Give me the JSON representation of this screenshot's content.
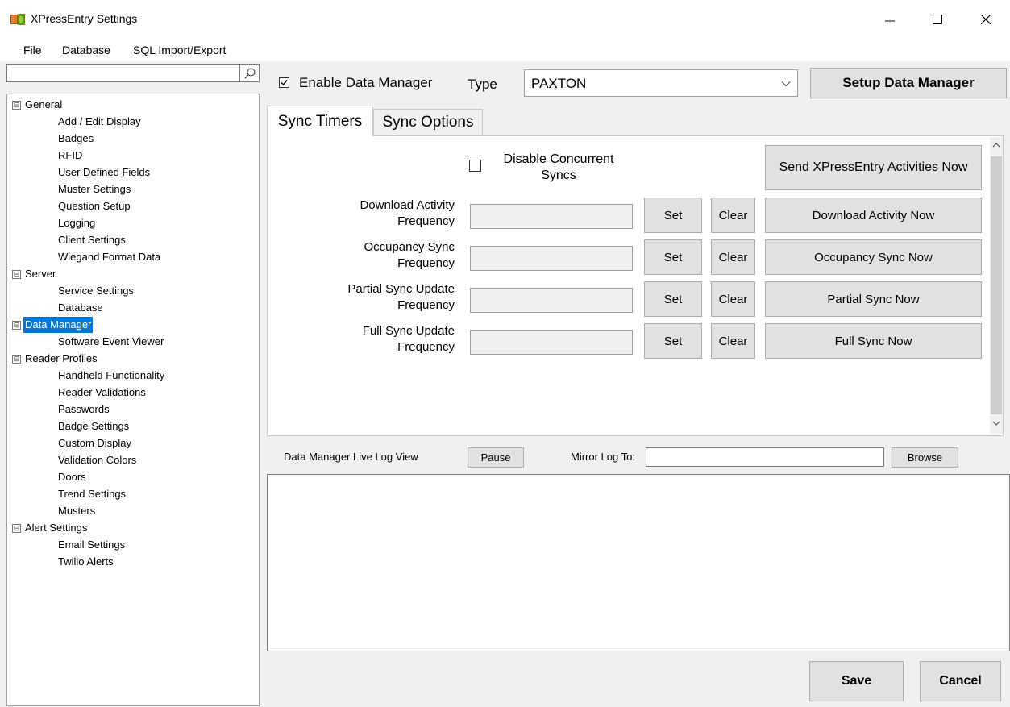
{
  "window": {
    "title": "XPressEntry Settings"
  },
  "menu": [
    "File",
    "Database",
    "SQL Import/Export"
  ],
  "search": {
    "value": "",
    "placeholder": ""
  },
  "tree": {
    "general": {
      "label": "General",
      "expander": "⊟",
      "children": [
        "Add / Edit Display",
        "Badges",
        "RFID",
        "User Defined Fields",
        "Muster Settings",
        "Question Setup",
        "Logging",
        "Client Settings",
        "Wiegand Format Data"
      ]
    },
    "server": {
      "label": "Server",
      "expander": "⊟",
      "children": [
        "Service Settings",
        "Database"
      ]
    },
    "data_manager": {
      "label": "Data Manager",
      "expander": "⊟",
      "children": [
        "Software Event Viewer"
      ],
      "selected": true
    },
    "reader_profiles": {
      "label": "Reader Profiles",
      "expander": "⊟",
      "children": [
        "Handheld Functionality",
        "Reader Validations",
        "Passwords",
        "Badge Settings",
        "Custom Display",
        "Validation Colors",
        "Doors",
        "Trend Settings",
        "Musters"
      ]
    },
    "alert_settings": {
      "label": "Alert Settings",
      "expander": "⊟",
      "children": [
        "Email Settings",
        "Twilio Alerts"
      ]
    }
  },
  "top": {
    "enable_label": "Enable Data Manager",
    "enable_checked": true,
    "type_label": "Type",
    "type_value": "PAXTON",
    "setup_button": "Setup Data Manager"
  },
  "tabs": [
    "Sync Timers",
    "Sync Options"
  ],
  "sync": {
    "disable_concurrent": "Disable Concurrent Syncs",
    "disable_concurrent_line1": "Disable Concurrent",
    "disable_concurrent_line2": "Syncs",
    "disable_concurrent_checked": false,
    "send_activities_button": "Send XPressEntry Activities Now",
    "rows": [
      {
        "label1": "Download Activity",
        "label2": "Frequency",
        "value": "",
        "set": "Set",
        "clear": "Clear",
        "action": "Download Activity Now"
      },
      {
        "label1": "Occupancy Sync",
        "label2": "Frequency",
        "value": "",
        "set": "Set",
        "clear": "Clear",
        "action": "Occupancy Sync Now"
      },
      {
        "label1": "Partial Sync Update",
        "label2": "Frequency",
        "value": "",
        "set": "Set",
        "clear": "Clear",
        "action": "Partial Sync Now"
      },
      {
        "label1": "Full Sync Update",
        "label2": "Frequency",
        "value": "",
        "set": "Set",
        "clear": "Clear",
        "action": "Full Sync Now"
      }
    ]
  },
  "log": {
    "title": "Data Manager Live Log View",
    "pause": "Pause",
    "mirror_label": "Mirror Log To:",
    "mirror_value": "",
    "browse": "Browse",
    "content": ""
  },
  "footer": {
    "save": "Save",
    "cancel": "Cancel"
  },
  "icons": {
    "search": "search-icon",
    "minimize": "minimize-icon",
    "maximize": "maximize-icon",
    "close": "close-icon",
    "dropdown": "chevron-down-icon"
  },
  "colors": {
    "selection": "#0078d7",
    "button": "#e1e1e1"
  }
}
